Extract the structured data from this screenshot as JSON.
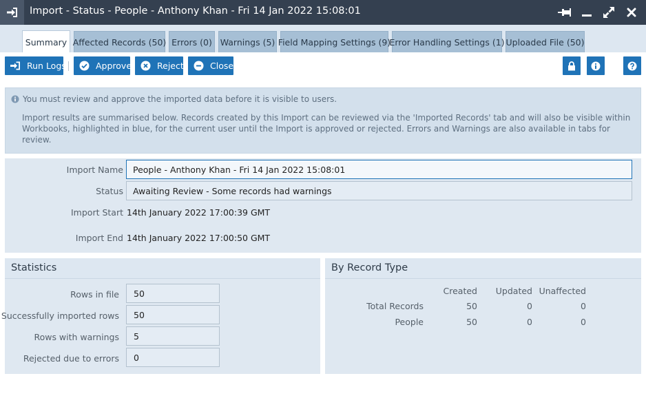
{
  "window": {
    "title": "Import - Status - People - Anthony Khan - Fri 14 Jan 2022 15:08:01",
    "app_icon": "sign-in-icon",
    "controls": [
      "pin-icon",
      "minimize-icon",
      "maximize-icon",
      "close-icon"
    ]
  },
  "tabs": [
    {
      "label": "Summary",
      "active": true
    },
    {
      "label": "Affected Records (50)"
    },
    {
      "label": "Errors (0)"
    },
    {
      "label": "Warnings (5)"
    },
    {
      "label": "Field Mapping Settings (9)"
    },
    {
      "label": "Error Handling Settings (1)"
    },
    {
      "label": "Uploaded File (50)"
    }
  ],
  "toolbar": {
    "run_logs": "Run Logs",
    "approve": "Approve",
    "reject": "Reject",
    "close": "Close",
    "right_icons": [
      "lock-icon",
      "info-icon",
      "help-icon"
    ]
  },
  "notice": {
    "line1": "You must review and approve the imported data before it is visible to users.",
    "line2": "Import results are summarised below. Records created by this Import can be reviewed via the 'Imported Records' tab and will also be visible within Workbooks, highlighted in blue, for the current user until the Import is approved or rejected. Errors and Warnings are also available in tabs for review."
  },
  "details": {
    "import_name_label": "Import Name",
    "import_name_value": "People - Anthony Khan - Fri 14 Jan 2022 15:08:01",
    "status_label": "Status",
    "status_value": "Awaiting Review - Some records had warnings",
    "import_start_label": "Import Start",
    "import_start_value": "14th January 2022 17:00:39 GMT",
    "import_end_label": "Import End",
    "import_end_value": "14th January 2022 17:00:50 GMT"
  },
  "statistics": {
    "title": "Statistics",
    "rows": [
      {
        "label": "Rows in file",
        "value": "50"
      },
      {
        "label": "Successfully imported rows",
        "value": "50"
      },
      {
        "label": "Rows with warnings",
        "value": "5"
      },
      {
        "label": "Rejected due to errors",
        "value": "0"
      }
    ]
  },
  "by_record_type": {
    "title": "By Record Type",
    "columns": [
      "Created",
      "Updated",
      "Unaffected"
    ],
    "rows": [
      {
        "label": "Total Records",
        "values": [
          "50",
          "0",
          "0"
        ]
      },
      {
        "label": "People",
        "values": [
          "50",
          "0",
          "0"
        ]
      }
    ]
  },
  "colors": {
    "titlebar": "#344050",
    "accent": "#1f73b7",
    "tab": "#a6bfd5",
    "panel": "#dfe8f1"
  }
}
